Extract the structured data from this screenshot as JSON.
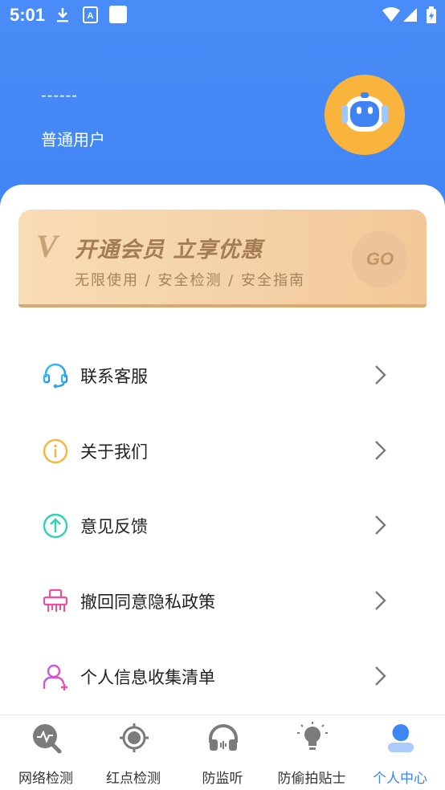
{
  "status_bar": {
    "time": "5:01"
  },
  "profile": {
    "username": "------",
    "user_type": "普通用户"
  },
  "vip_banner": {
    "badge": "V",
    "title": "开通会员  立享优惠",
    "subtitle": "无限使用 / 安全检测 / 安全指南",
    "go_label": "GO"
  },
  "menu": {
    "items": [
      {
        "label": "联系客服",
        "icon": "headset-icon"
      },
      {
        "label": "关于我们",
        "icon": "info-icon"
      },
      {
        "label": "意见反馈",
        "icon": "upload-feedback-icon"
      },
      {
        "label": "撤回同意隐私政策",
        "icon": "shredder-icon"
      },
      {
        "label": "个人信息收集清单",
        "icon": "user-add-icon"
      }
    ]
  },
  "bottom_nav": {
    "items": [
      {
        "label": "网络检测",
        "icon": "network-scan-icon",
        "active": false
      },
      {
        "label": "红点检测",
        "icon": "camera-lens-icon",
        "active": false
      },
      {
        "label": "防监听",
        "icon": "headphones-icon",
        "active": false
      },
      {
        "label": "防偷拍贴士",
        "icon": "lightbulb-icon",
        "active": false
      },
      {
        "label": "个人中心",
        "icon": "profile-icon",
        "active": true
      }
    ]
  },
  "colors": {
    "header_blue": "#4a8cf7",
    "active_nav": "#3d86f5",
    "avatar_orange": "#f8b43c"
  }
}
